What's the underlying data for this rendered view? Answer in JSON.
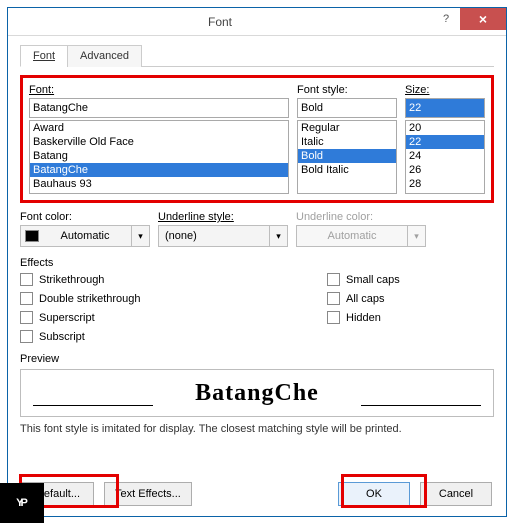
{
  "titlebar": {
    "title": "Font",
    "help": "?",
    "close": "×"
  },
  "tabs": {
    "font": "Font",
    "advanced": "Advanced"
  },
  "fontSection": {
    "fontLabel": "Font:",
    "fontValue": "BatangChe",
    "fontList": [
      "Award",
      "Baskerville Old Face",
      "Batang",
      "BatangChe",
      "Bauhaus 93"
    ],
    "fontSelectedIndex": 3,
    "styleLabel": "Font style:",
    "styleValue": "Bold",
    "styleList": [
      "Regular",
      "Italic",
      "Bold",
      "Bold Italic"
    ],
    "styleSelectedIndex": 2,
    "sizeLabel": "Size:",
    "sizeValue": "22",
    "sizeList": [
      "20",
      "22",
      "24",
      "26",
      "28"
    ],
    "sizeSelectedIndex": 1
  },
  "combos": {
    "fontColorLabel": "Font color:",
    "fontColorValue": "Automatic",
    "underlineStyleLabel": "Underline style:",
    "underlineStyleValue": "(none)",
    "underlineColorLabel": "Underline color:",
    "underlineColorValue": "Automatic"
  },
  "effects": {
    "label": "Effects",
    "strikethrough": "Strikethrough",
    "doubleStrike": "Double strikethrough",
    "superscript": "Superscript",
    "subscript": "Subscript",
    "smallCaps": "Small caps",
    "allCaps": "All caps",
    "hidden": "Hidden"
  },
  "preview": {
    "label": "Preview",
    "text": "BatangChe",
    "note": "This font style is imitated for display. The closest matching style will be printed."
  },
  "buttons": {
    "default": "Default...",
    "textEffects": "Text Effects...",
    "ok": "OK",
    "cancel": "Cancel"
  },
  "logo": {
    "y": "Y",
    "p": "P"
  }
}
